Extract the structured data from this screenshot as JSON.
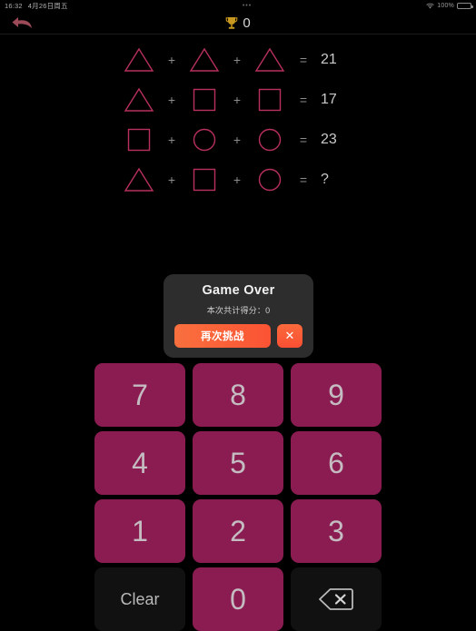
{
  "statusbar": {
    "time": "16:32",
    "date": "4月26日周五",
    "center": "•••",
    "battery_pct": "100%",
    "wifi_icon": "wifi-icon",
    "battery_icon": "battery-icon"
  },
  "header": {
    "back_icon": "back-arrow-icon",
    "trophy_icon": "trophy-icon",
    "score": "0"
  },
  "puzzle": {
    "rows": [
      {
        "a": "triangle",
        "b": "triangle",
        "c": "triangle",
        "op1": "+",
        "op2": "+",
        "eq": "=",
        "value": "21"
      },
      {
        "a": "triangle",
        "b": "square",
        "c": "square",
        "op1": "+",
        "op2": "+",
        "eq": "=",
        "value": "17"
      },
      {
        "a": "square",
        "b": "circle",
        "c": "circle",
        "op1": "+",
        "op2": "+",
        "eq": "=",
        "value": "23"
      },
      {
        "a": "triangle",
        "b": "square",
        "c": "circle",
        "op1": "+",
        "op2": "+",
        "eq": "=",
        "value": "?"
      }
    ],
    "shape_color": "#b8305f"
  },
  "dialog": {
    "title": "Game Over",
    "subtitle": "本次共计得分：0",
    "retry_label": "再次挑战",
    "close_label": "✕",
    "close_icon": "close-icon",
    "accent": "#fa5a36",
    "background": "#2d2d2d"
  },
  "keypad": {
    "keys": [
      {
        "label": "7",
        "kind": "num",
        "name": "key-7"
      },
      {
        "label": "8",
        "kind": "num",
        "name": "key-8"
      },
      {
        "label": "9",
        "kind": "num",
        "name": "key-9"
      },
      {
        "label": "4",
        "kind": "num",
        "name": "key-4"
      },
      {
        "label": "5",
        "kind": "num",
        "name": "key-5"
      },
      {
        "label": "6",
        "kind": "num",
        "name": "key-6"
      },
      {
        "label": "1",
        "kind": "num",
        "name": "key-1"
      },
      {
        "label": "2",
        "kind": "num",
        "name": "key-2"
      },
      {
        "label": "3",
        "kind": "num",
        "name": "key-3"
      },
      {
        "label": "Clear",
        "kind": "dark",
        "name": "key-clear"
      },
      {
        "label": "0",
        "kind": "num",
        "name": "key-0"
      },
      {
        "label": "",
        "kind": "icon",
        "name": "key-backspace",
        "icon": "backspace-icon"
      }
    ],
    "num_color": "#8a1c52",
    "dark_color": "#111111"
  }
}
